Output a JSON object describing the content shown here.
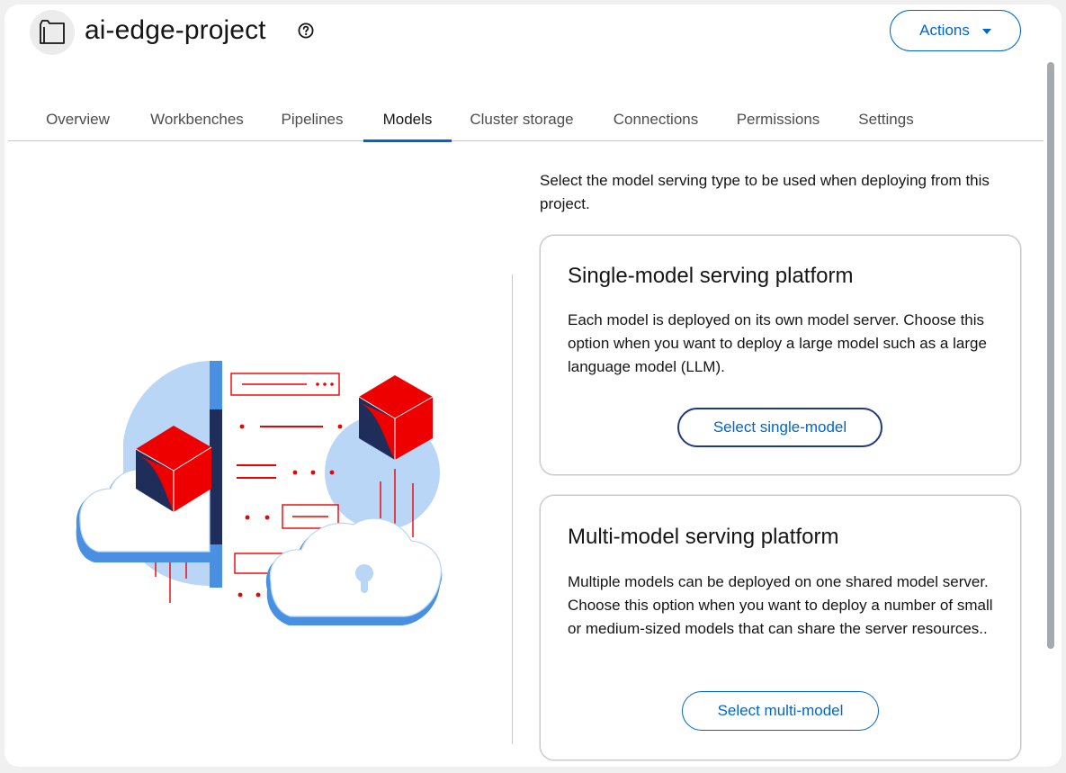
{
  "header": {
    "project_title": "ai-edge-project",
    "actions_label": "Actions"
  },
  "tabs": [
    {
      "label": "Overview"
    },
    {
      "label": "Workbenches"
    },
    {
      "label": "Pipelines"
    },
    {
      "label": "Models"
    },
    {
      "label": "Cluster storage"
    },
    {
      "label": "Connections"
    },
    {
      "label": "Permissions"
    },
    {
      "label": "Settings"
    }
  ],
  "main": {
    "intro": "Select the model serving type to be used when deploying from this project.",
    "cards": [
      {
        "title": "Single-model serving platform",
        "body": "Each model is deployed on its own model server. Choose this option when you want to deploy a large model such as a large language model (LLM).",
        "button": "Select single-model"
      },
      {
        "title": "Multi-model serving platform",
        "body": "Multiple models can be deployed on one shared model server. Choose this option when you want to deploy a number of small or medium-sized models that can share the server resources..",
        "button": "Select multi-model"
      }
    ]
  },
  "colors": {
    "accent": "#0066cc",
    "illustration_red": "#ee0000",
    "illustration_blue": "#b9d6f7",
    "illustration_navy": "#1f2d5a"
  }
}
